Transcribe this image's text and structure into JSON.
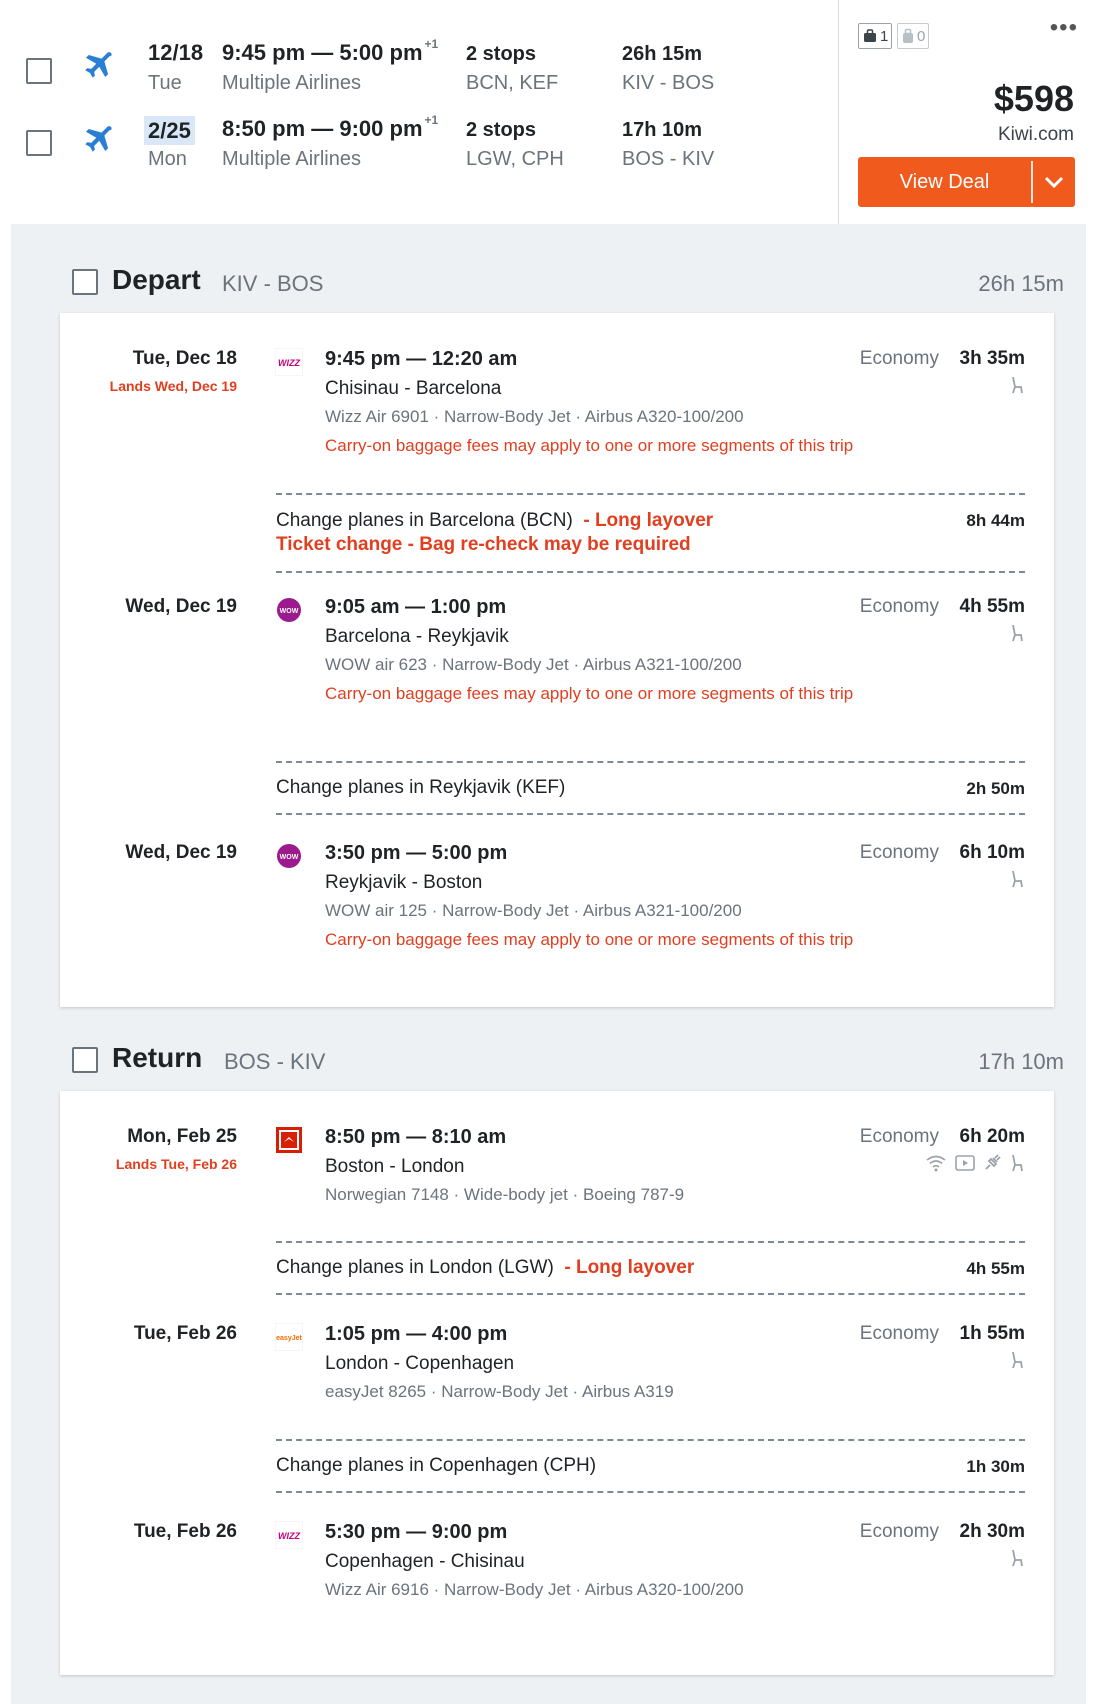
{
  "summary": {
    "legs": [
      {
        "date": "12/18",
        "dow": "Tue",
        "dep_arr": "9:45 pm — 5:00 pm",
        "plus_day": "+1",
        "airlines": "Multiple Airlines",
        "stops": "2 stops",
        "stop_codes": "BCN, KEF",
        "duration": "26h 15m",
        "route": "KIV - BOS"
      },
      {
        "date": "2/25",
        "dow": "Mon",
        "dep_arr": "8:50 pm — 9:00 pm",
        "plus_day": "+1",
        "airlines": "Multiple Airlines",
        "stops": "2 stops",
        "stop_codes": "LGW, CPH",
        "duration": "17h 10m",
        "route": "BOS - KIV"
      }
    ],
    "carry_on_count": "1",
    "checked_bag_count": "0",
    "more": "•••",
    "price": "$598",
    "provider": "Kiwi.com",
    "deal_label": "View Deal"
  },
  "colors": {
    "accent": "#f05a1d",
    "warning": "#e13f1f",
    "plane_blue": "#2a7fd4"
  },
  "depart": {
    "title": "Depart",
    "route": "KIV - BOS",
    "duration": "26h 15m",
    "segments": [
      {
        "date": "Tue, Dec 18",
        "lands": "Lands Wed, Dec 19",
        "logo": "wizz-logo",
        "logo_text": "WIZZ",
        "times": "9:45 pm — 12:20 am",
        "cities": "Chisinau - Barcelona",
        "flight": "Wizz Air 6901 · Narrow-Body Jet · Airbus A320-100/200",
        "warn": "Carry-on baggage fees may apply to one or more segments of this trip",
        "cabin": "Economy",
        "duration": "3h 35m"
      },
      {
        "date": "Wed, Dec 19",
        "lands": "",
        "logo": "wow-logo",
        "logo_text": "WOW",
        "times": "9:05 am — 1:00 pm",
        "cities": "Barcelona - Reykjavik",
        "flight": "WOW air 623 · Narrow-Body Jet · Airbus A321-100/200",
        "warn": "Carry-on baggage fees may apply to one or more segments of this trip",
        "cabin": "Economy",
        "duration": "4h 55m"
      },
      {
        "date": "Wed, Dec 19",
        "lands": "",
        "logo": "wow-logo",
        "logo_text": "WOW",
        "times": "3:50 pm — 5:00 pm",
        "cities": "Reykjavik - Boston",
        "flight": "WOW air 125 · Narrow-Body Jet · Airbus A321-100/200",
        "warn": "Carry-on baggage fees may apply to one or more segments of this trip",
        "cabin": "Economy",
        "duration": "6h 10m"
      }
    ],
    "layovers": [
      {
        "text": "Change planes in Barcelona (BCN)",
        "flag": "- Long layover",
        "flag2": "Ticket change - Bag re-check may be required",
        "duration": "8h 44m"
      },
      {
        "text": "Change planes in Reykjavik (KEF)",
        "flag": "",
        "flag2": "",
        "duration": "2h 50m"
      }
    ]
  },
  "return": {
    "title": "Return",
    "route": "BOS - KIV",
    "duration": "17h 10m",
    "segments": [
      {
        "date": "Mon, Feb 25",
        "lands": "Lands Tue, Feb 26",
        "logo": "norwegian-logo",
        "logo_text": "",
        "times": "8:50 pm — 8:10 am",
        "cities": "Boston - London",
        "flight": "Norwegian 7148 · Wide-body jet · Boeing 787-9",
        "warn": "",
        "cabin": "Economy",
        "duration": "6h 20m"
      },
      {
        "date": "Tue, Feb 26",
        "lands": "",
        "logo": "easyjet-logo",
        "logo_text": "easyJet",
        "times": "1:05 pm — 4:00 pm",
        "cities": "London - Copenhagen",
        "flight": "easyJet 8265 · Narrow-Body Jet · Airbus A319",
        "warn": "",
        "cabin": "Economy",
        "duration": "1h 55m"
      },
      {
        "date": "Tue, Feb 26",
        "lands": "",
        "logo": "wizz-logo",
        "logo_text": "WIZZ",
        "times": "5:30 pm — 9:00 pm",
        "cities": "Copenhagen - Chisinau",
        "flight": "Wizz Air 6916 · Narrow-Body Jet · Airbus A320-100/200",
        "warn": "",
        "cabin": "Economy",
        "duration": "2h 30m"
      }
    ],
    "layovers": [
      {
        "text": "Change planes in London (LGW)",
        "flag": "- Long layover",
        "flag2": "",
        "duration": "4h 55m"
      },
      {
        "text": "Change planes in Copenhagen (CPH)",
        "flag": "",
        "flag2": "",
        "duration": "1h 30m"
      }
    ]
  }
}
